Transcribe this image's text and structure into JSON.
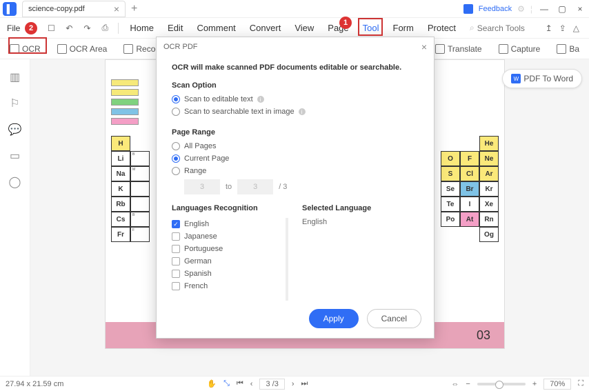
{
  "titlebar": {
    "filename": "science-copy.pdf",
    "feedback": "Feedback"
  },
  "menu": {
    "file": "File",
    "items": [
      "Home",
      "Edit",
      "Comment",
      "Convert",
      "View",
      "Page",
      "Tool",
      "Form",
      "Protect"
    ],
    "search_placeholder": "Search Tools"
  },
  "ribbon": {
    "ocr": "OCR",
    "ocr_area": "OCR Area",
    "recognize": "Recogn",
    "translate": "Translate",
    "capture": "Capture",
    "batch": "Ba"
  },
  "pdf_to_word": "PDF To Word",
  "periodic": {
    "left": [
      "H",
      "Li",
      "Na",
      "K",
      "Rb",
      "Cs",
      "Fr"
    ],
    "left_sub": [
      "",
      "B",
      "M",
      "",
      "",
      "B",
      "F"
    ],
    "right_c1": [
      "",
      "O",
      "S",
      "Se",
      "Te",
      "Po",
      ""
    ],
    "right_c2": [
      "",
      "F",
      "Cl",
      "Br",
      "I",
      "At",
      ""
    ],
    "right_c3": [
      "He",
      "Ne",
      "Ar",
      "Kr",
      "Xe",
      "Rn",
      "Og"
    ]
  },
  "page_footer": "03",
  "dialog": {
    "title": "OCR PDF",
    "subtitle": "OCR will make scanned PDF documents editable or searchable.",
    "scan_label": "Scan Option",
    "scan_opt1": "Scan to editable text",
    "scan_opt2": "Scan to searchable text in image",
    "range_label": "Page Range",
    "range_opt1": "All Pages",
    "range_opt2": "Current Page",
    "range_opt3": "Range",
    "range_from": "3",
    "range_to_lbl": "to",
    "range_to": "3",
    "range_total": "/ 3",
    "lang_label": "Languages Recognition",
    "sel_label": "Selected Language",
    "sel_value": "English",
    "languages": [
      "English",
      "Japanese",
      "Portuguese",
      "German",
      "Spanish",
      "French"
    ],
    "apply": "Apply",
    "cancel": "Cancel"
  },
  "status": {
    "dims": "27.94 x 21.59 cm",
    "page_label": "3 /3",
    "zoom": "70%"
  },
  "callouts": {
    "one": "1",
    "two": "2"
  }
}
